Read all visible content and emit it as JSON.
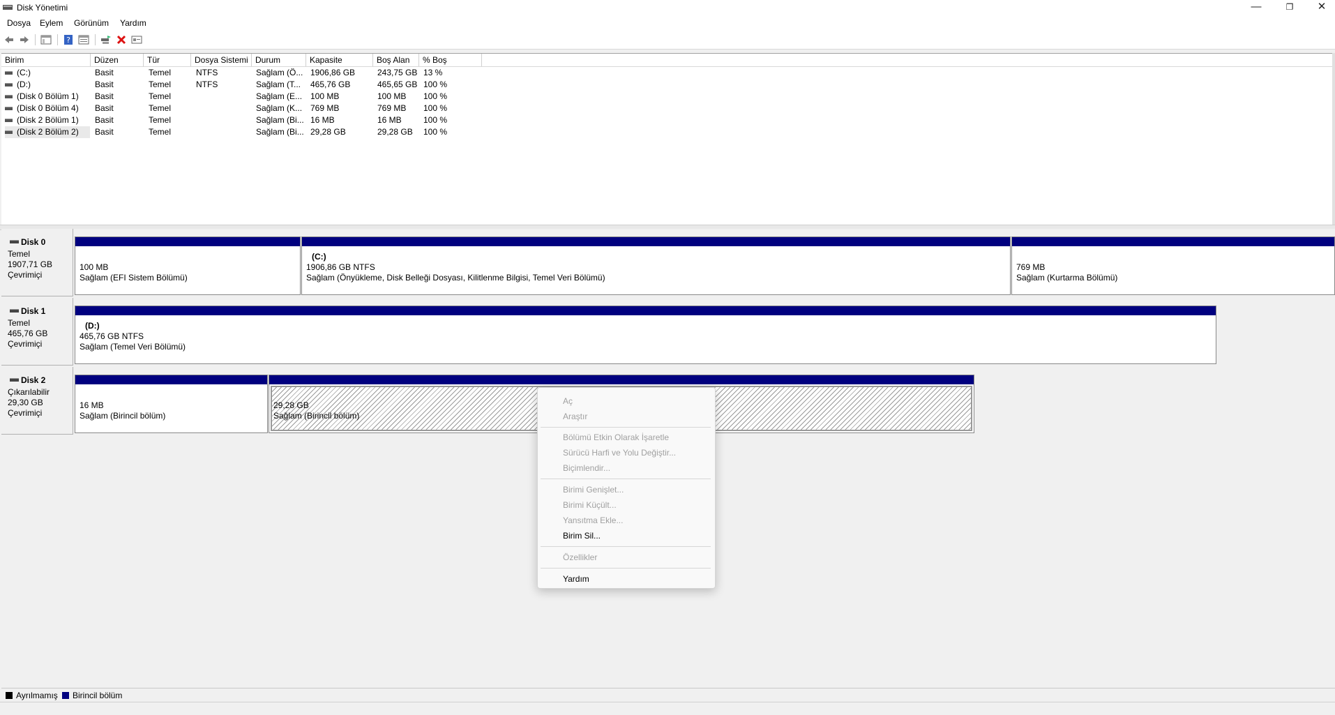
{
  "window": {
    "title": "Disk Yönetimi",
    "controls": {
      "minimize": "—",
      "maximize": "❐",
      "close": "✕"
    }
  },
  "menu": [
    "Dosya",
    "Eylem",
    "Görünüm",
    "Yardım"
  ],
  "toolbar": {
    "icons": [
      "back-icon",
      "forward-icon",
      "console-tree-icon",
      "help-icon",
      "properties-icon",
      "rescan-icon",
      "delete-icon",
      "settings-icon"
    ]
  },
  "volumes": {
    "columns": [
      "Birim",
      "Düzen",
      "Tür",
      "Dosya Sistemi",
      "Durum",
      "Kapasite",
      "Boş Alan",
      "% Boş"
    ],
    "rows": [
      [
        "(C:)",
        "Basit",
        "Temel",
        "NTFS",
        "Sağlam (Ö...",
        "1906,86 GB",
        "243,75 GB",
        "13 %"
      ],
      [
        "(D:)",
        "Basit",
        "Temel",
        "NTFS",
        "Sağlam (T...",
        "465,76 GB",
        "465,65 GB",
        "100 %"
      ],
      [
        "(Disk 0 Bölüm 1)",
        "Basit",
        "Temel",
        "",
        "Sağlam (E...",
        "100 MB",
        "100 MB",
        "100 %"
      ],
      [
        "(Disk 0 Bölüm 4)",
        "Basit",
        "Temel",
        "",
        "Sağlam (K...",
        "769 MB",
        "769 MB",
        "100 %"
      ],
      [
        "(Disk 2 Bölüm 1)",
        "Basit",
        "Temel",
        "",
        "Sağlam (Bi...",
        "16 MB",
        "16 MB",
        "100 %"
      ],
      [
        "(Disk 2 Bölüm 2)",
        "Basit",
        "Temel",
        "",
        "Sağlam (Bi...",
        "29,28 GB",
        "29,28 GB",
        "100 %"
      ]
    ]
  },
  "disks": [
    {
      "name": "Disk 0",
      "type": "Temel",
      "size": "1907,71 GB",
      "status": "Çevrimiçi",
      "partitions": [
        {
          "label": "",
          "size": "100 MB",
          "status": "Sağlam (EFI Sistem Bölümü)"
        },
        {
          "label": "(C:)",
          "size": "1906,86 GB NTFS",
          "status": "Sağlam (Önyükleme, Disk Belleği Dosyası, Kilitlenme Bilgisi, Temel Veri Bölümü)"
        },
        {
          "label": "",
          "size": "769 MB",
          "status": "Sağlam (Kurtarma Bölümü)"
        }
      ]
    },
    {
      "name": "Disk 1",
      "type": "Temel",
      "size": "465,76 GB",
      "status": "Çevrimiçi",
      "partitions": [
        {
          "label": "(D:)",
          "size": "465,76 GB NTFS",
          "status": "Sağlam (Temel Veri Bölümü)"
        }
      ]
    },
    {
      "name": "Disk 2",
      "type": "Çıkarılabilir",
      "size": "29,30 GB",
      "status": "Çevrimiçi",
      "partitions": [
        {
          "label": "",
          "size": "16 MB",
          "status": "Sağlam (Birincil bölüm)"
        },
        {
          "label": "",
          "size": "29,28 GB",
          "status": "Sağlam (Birincil bölüm)"
        }
      ]
    }
  ],
  "legend": {
    "unallocated": {
      "label": "Ayrılmamış",
      "color": "#000000"
    },
    "primary": {
      "label": "Birincil bölüm",
      "color": "#00007f"
    }
  },
  "context_menu": {
    "items": [
      {
        "label": "Aç",
        "enabled": false
      },
      {
        "label": "Araştır",
        "enabled": false
      },
      {
        "label": "Bölümü Etkin Olarak İşaretle",
        "enabled": false
      },
      {
        "label": "Sürücü Harfi ve Yolu Değiştir...",
        "enabled": false
      },
      {
        "label": "Biçimlendir...",
        "enabled": false
      },
      {
        "label": "Birimi Genişlet...",
        "enabled": false
      },
      {
        "label": "Birimi Küçült...",
        "enabled": false
      },
      {
        "label": "Yansıtma Ekle...",
        "enabled": false
      },
      {
        "label": "Birim Sil...",
        "enabled": true
      },
      {
        "label": "Özellikler",
        "enabled": false
      },
      {
        "label": "Yardım",
        "enabled": true
      }
    ]
  },
  "colors": {
    "partition_bar": "#00007f",
    "disabled_text": "#a0a0a0"
  }
}
